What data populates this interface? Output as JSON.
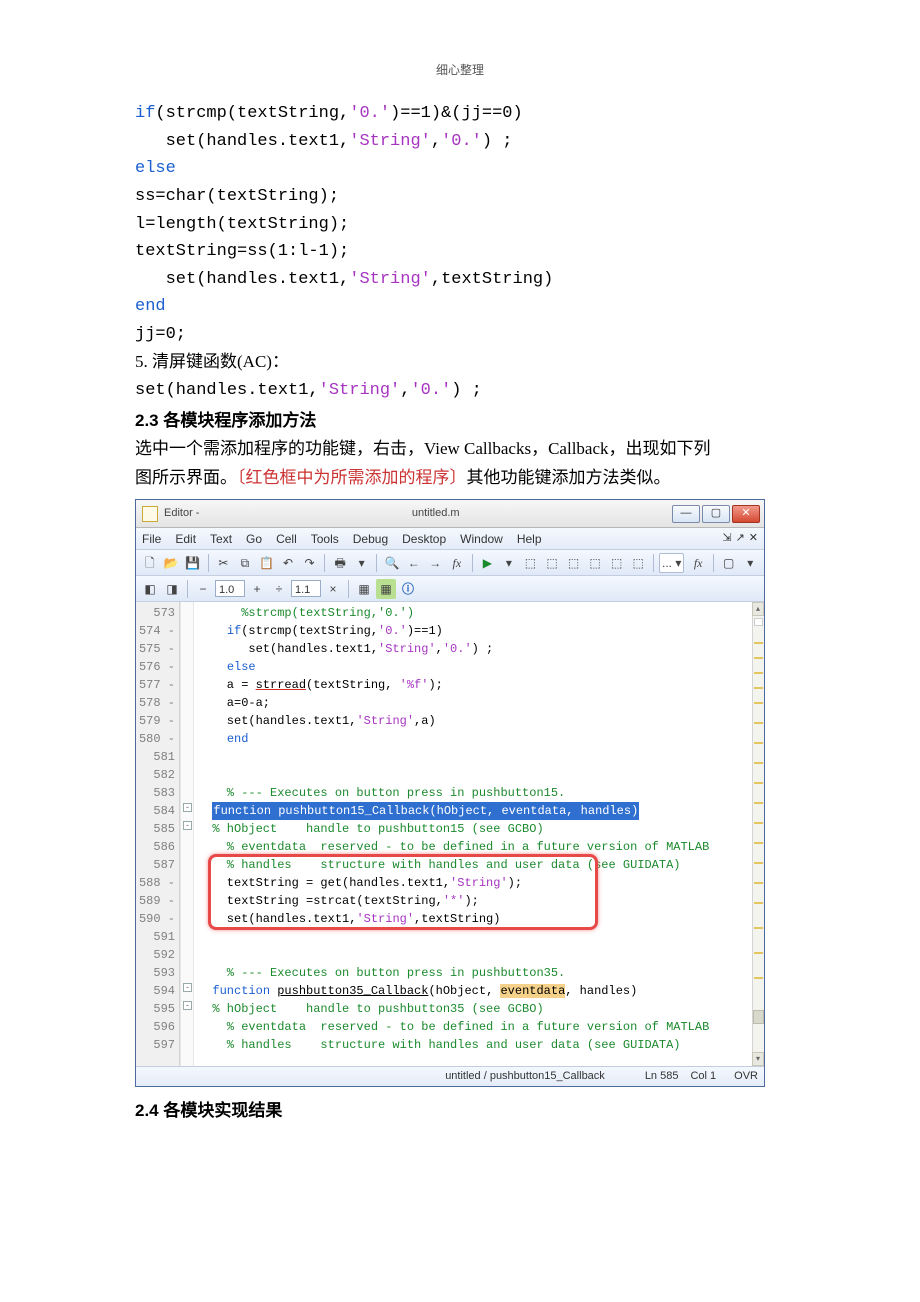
{
  "header": "细心整理",
  "code1": {
    "l1_a": "if",
    "l1_b": "(strcmp(textString,",
    "l1_c": "'0.'",
    "l1_d": ")==1)&(jj==0)",
    "l2_a": "   set(handles.text1,",
    "l2_b": "'String'",
    "l2_c": ",",
    "l2_d": "'0.'",
    "l2_e": ") ;",
    "l3": "else",
    "l4": "ss=char(textString);",
    "l5": "l=length(textString);",
    "l6": "textString=ss(1:l-1);",
    "l7_a": "   set(handles.text1,",
    "l7_b": "'String'",
    "l7_c": ",textString)",
    "l8": "end",
    "l9": "jj=0;"
  },
  "prose1": "5. 清屏键函数(AC)：",
  "code2_a": "set(handles.text1,",
  "code2_b": "'String'",
  "code2_c": ",",
  "code2_d": "'0.'",
  "code2_e": ") ;",
  "heading1": "2.3 各模块程序添加方法",
  "prose2a": "选中一个需添加程序的功能键，右击，View Callbacks，Callback，出现如下列",
  "prose2b": "图所示界面。",
  "redNote": "〔红色框中为所需添加的程序〕",
  "prose2c": "其他功能键添加方法类似。",
  "editor": {
    "titleApp": "Editor -",
    "titlePath": "untitled.m",
    "menu": [
      "File",
      "Edit",
      "Text",
      "Go",
      "Cell",
      "Tools",
      "Debug",
      "Desktop",
      "Window",
      "Help"
    ],
    "tool2_val1": "1.0",
    "tool2_val2": "1.1",
    "tool2_plus": "+",
    "tool2_div": "÷",
    "tool2_minus": "−",
    "tool2_times": "×",
    "lines": [
      "573",
      "574",
      "575",
      "576",
      "577",
      "578",
      "579",
      "580",
      "581",
      "582",
      "583",
      "584",
      "585",
      "586",
      "587",
      "588",
      "589",
      "590",
      "591",
      "592",
      "593",
      "594",
      "595",
      "596",
      "597"
    ],
    "code": {
      "573": {
        "t": "      %strcmp(textString,'0.')",
        "cls": "e-green"
      },
      "574": {
        "pre": "    ",
        "kw": "if",
        "rest": "(strcmp(textString,",
        "s1": "'0.'",
        "tail": ")==1)"
      },
      "575": {
        "pre": "       set(handles.text1,",
        "s1": "'String'",
        "mid": ",",
        "s2": "'0.'",
        "tail": ") ;"
      },
      "576": {
        "pre": "    ",
        "kw": "else"
      },
      "577": {
        "pre": "    a = ",
        "u": "strread",
        "rest": "(textString, ",
        "s1": "'%f'",
        "tail": ");"
      },
      "578": {
        "t": "    a=0-a;"
      },
      "579": {
        "pre": "    set(handles.text1,",
        "s1": "'String'",
        "tail": ",a)"
      },
      "580": {
        "pre": "    ",
        "kw": "end"
      },
      "581": {
        "t": ""
      },
      "582": {
        "t": ""
      },
      "583": {
        "t": "    % --- Executes on button press in pushbutton15.",
        "cls": "e-green"
      },
      "584": {
        "hl": "function pushbutton15_Callback(hObject, eventdata, handles)"
      },
      "585": {
        "t": "  % hObject    handle to pushbutton15 (see GCBO)",
        "cls": "e-green"
      },
      "586": {
        "t": "    % eventdata  reserved - to be defined in a future version of MATLAB",
        "cls": "e-green"
      },
      "587": {
        "t": "    % handles    structure with handles and user data (see GUIDATA)",
        "cls": "e-green"
      },
      "588": {
        "pre": "    textString = get(handles.text1,",
        "s1": "'String'",
        "tail": ");"
      },
      "589": {
        "pre": "    textString =strcat(textString,",
        "s1": "'*'",
        "tail": ");"
      },
      "590": {
        "pre": "    set(handles.text1,",
        "s1": "'String'",
        "tail": ",textString)"
      },
      "591": {
        "t": ""
      },
      "592": {
        "t": ""
      },
      "593": {
        "t": "    % --- Executes on button press in pushbutton35.",
        "cls": "e-green"
      },
      "594": {
        "kw": "function",
        "sp": " ",
        "u": "pushbutton35_Callback",
        "rest": "(hObject, ",
        "ohl": "eventdata",
        "tail": ", handles)"
      },
      "595": {
        "t": "  % hObject    handle to pushbutton35 (see GCBO)",
        "cls": "e-green"
      },
      "596": {
        "t": "    % eventdata  reserved - to be defined in a future version of MATLAB",
        "cls": "e-green"
      },
      "597": {
        "t": "    % handles    structure with handles and user data (see GUIDATA)",
        "cls": "e-green"
      }
    },
    "status": {
      "path": "untitled / pushbutton15_Callback",
      "ln": "Ln  585",
      "col": "Col  1",
      "ovr": "OVR"
    }
  },
  "heading2": "2.4 各模块实现结果"
}
